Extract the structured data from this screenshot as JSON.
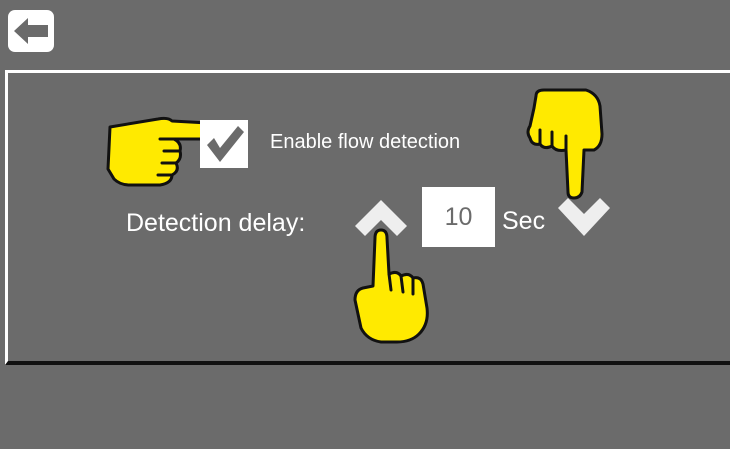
{
  "header": {
    "back_icon": "arrow-left-icon"
  },
  "flow_detection": {
    "checkbox_label": "Enable flow detection",
    "checked": true
  },
  "delay": {
    "label": "Detection delay:",
    "value": "10",
    "unit": "Sec",
    "increase_icon": "chevron-up-icon",
    "decrease_icon": "chevron-down-icon"
  },
  "colors": {
    "background": "#6b6b6b",
    "hint_hand": "#ffea00",
    "foreground": "#ffffff"
  }
}
